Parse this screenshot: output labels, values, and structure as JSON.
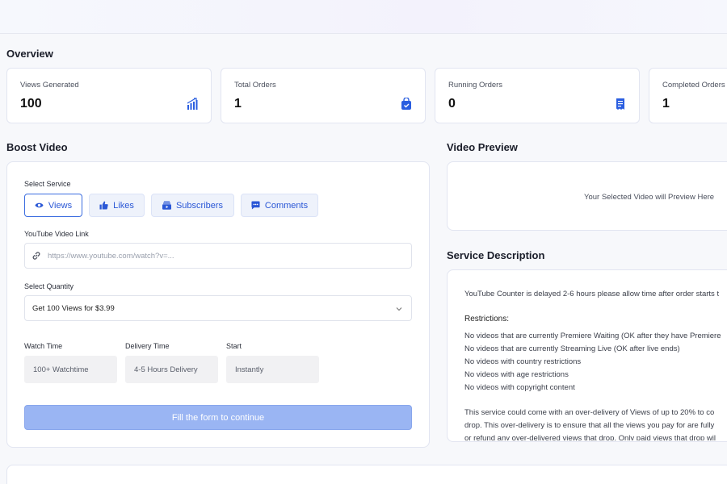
{
  "overview": {
    "title": "Overview",
    "cards": [
      {
        "label": "Views Generated",
        "value": "100",
        "icon": "chart-bar-icon"
      },
      {
        "label": "Total Orders",
        "value": "1",
        "icon": "shopping-bag-icon"
      },
      {
        "label": "Running Orders",
        "value": "0",
        "icon": "receipt-icon"
      },
      {
        "label": "Completed Orders",
        "value": "1",
        "icon": "check-icon"
      }
    ]
  },
  "boost": {
    "title": "Boost Video",
    "service_label": "Select Service",
    "services": [
      {
        "label": "Views",
        "icon": "eye-icon",
        "active": true
      },
      {
        "label": "Likes",
        "icon": "thumbs-up-icon",
        "active": false
      },
      {
        "label": "Subscribers",
        "icon": "subscribers-icon",
        "active": false
      },
      {
        "label": "Comments",
        "icon": "comment-icon",
        "active": false
      }
    ],
    "link_label": "YouTube Video Link",
    "link_placeholder": "https://www.youtube.com/watch?v=...",
    "quantity_label": "Select Quantity",
    "quantity_selected": "Get 100 Views for $3.99",
    "watch_time_label": "Watch Time",
    "watch_time_value": "100+ Watchtime",
    "delivery_time_label": "Delivery Time",
    "delivery_time_value": "4-5 Hours Delivery",
    "start_label": "Start",
    "start_value": "Instantly",
    "submit_label": "Fill the form to continue"
  },
  "preview": {
    "title": "Video Preview",
    "placeholder": "Your Selected Video will Preview Here"
  },
  "description": {
    "title": "Service Description",
    "intro": "YouTube Counter is delayed 2-6 hours please allow time after order starts t",
    "restrictions_title": "Restrictions:",
    "restrictions": [
      "No videos that are currently Premiere Waiting (OK after they have Premiere",
      "No videos that are currently Streaming Live (OK after live ends)",
      "No videos with country restrictions",
      "No videos with age restrictions",
      "No videos with copyright content"
    ],
    "paragraph": [
      "This service could come with an over-delivery of Views of up to 20% to co",
      "drop. This over-delivery is to ensure that all the views you pay for are fully",
      "or refund any over-delivered views that drop. Only paid views that drop wil"
    ]
  },
  "colors": {
    "accent": "#3b6de0",
    "accent_light": "#9ab5f3"
  }
}
